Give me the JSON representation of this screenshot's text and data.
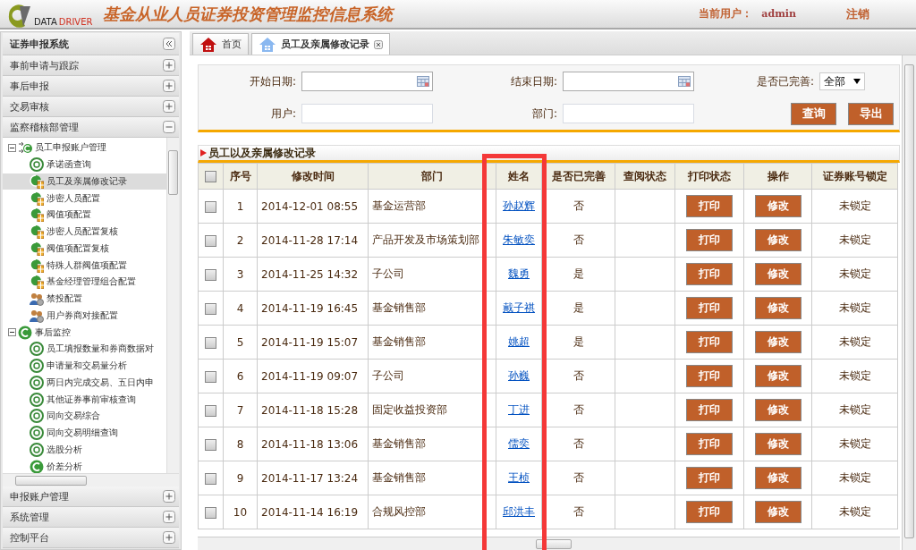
{
  "header": {
    "logo_words": [
      "DATA",
      "DRIVER"
    ],
    "title": "基金从业人员证券投资管理监控信息系统",
    "user_label": "当前用户：",
    "user": "admin",
    "logout": "注销"
  },
  "sidebar": {
    "title": "证券申报系统",
    "sections": [
      {
        "label": "事前申请与跟踪",
        "expanded": false
      },
      {
        "label": "事后申报",
        "expanded": false
      },
      {
        "label": "交易审核",
        "expanded": false
      },
      {
        "label": "监察稽核部管理",
        "expanded": true,
        "tree": [
          {
            "label": "员工申报账户管理",
            "kind": "folder",
            "expanded": true,
            "selected": false,
            "children": [
              {
                "label": "承诺函查询",
                "kind": "query",
                "selected": false
              },
              {
                "label": "员工及亲属修改记录",
                "kind": "config",
                "selected": true
              },
              {
                "label": "涉密人员配置",
                "kind": "config",
                "selected": false
              },
              {
                "label": "阀值项配置",
                "kind": "config",
                "selected": false
              },
              {
                "label": "涉密人员配置复核",
                "kind": "config",
                "selected": false
              },
              {
                "label": "阀值项配置复核",
                "kind": "config",
                "selected": false
              },
              {
                "label": "特殊人群阀值项配置",
                "kind": "config",
                "selected": false
              },
              {
                "label": "基金经理管理组合配置",
                "kind": "config",
                "selected": false
              },
              {
                "label": "禁投配置",
                "kind": "people",
                "selected": false
              },
              {
                "label": "用户券商对接配置",
                "kind": "people",
                "selected": false
              }
            ]
          },
          {
            "label": "事后监控",
            "kind": "group",
            "expanded": true,
            "selected": false,
            "children": [
              {
                "label": "员工填报数量和券商数据对",
                "kind": "query",
                "selected": false
              },
              {
                "label": "申请量和交易量分析",
                "kind": "query",
                "selected": false
              },
              {
                "label": "两日内完成交易、五日内申",
                "kind": "query",
                "selected": false
              },
              {
                "label": "其他证券事前审核查询",
                "kind": "query",
                "selected": false
              },
              {
                "label": "同向交易综合",
                "kind": "query",
                "selected": false
              },
              {
                "label": "同向交易明细查询",
                "kind": "query",
                "selected": false
              },
              {
                "label": "选股分析",
                "kind": "query",
                "selected": false
              },
              {
                "label": "价差分析",
                "kind": "group",
                "selected": false
              }
            ]
          }
        ]
      },
      {
        "label": "申报账户管理",
        "expanded": false
      },
      {
        "label": "系统管理",
        "expanded": false
      },
      {
        "label": "控制平台",
        "expanded": false
      }
    ]
  },
  "tabs": [
    {
      "label": "首页",
      "kind": "home",
      "selected": false,
      "closable": false
    },
    {
      "label": "员工及亲属修改记录",
      "kind": "page",
      "selected": true,
      "closable": true
    }
  ],
  "filters": {
    "start_date": {
      "label": "开始日期:"
    },
    "end_date": {
      "label": "结束日期:"
    },
    "complete": {
      "label": "是否已完善:",
      "value": "全部"
    },
    "user": {
      "label": "用户:"
    },
    "department": {
      "label": "部门:"
    },
    "buttons": [
      "查询",
      "导出"
    ]
  },
  "table": {
    "title": "员工以及亲属修改记录",
    "header_checked": false,
    "columns": [
      "序号",
      "修改时间",
      "部门",
      "姓名",
      "是否已完善",
      "查阅状态",
      "打印状态",
      "操作",
      "证券账号锁定"
    ],
    "rows": [
      {
        "checked": false,
        "no": "1",
        "time": "2014-12-01 08:55",
        "department": "基金运营部",
        "name": "孙赵辉",
        "complete": "否",
        "print": "打印",
        "edit": "修改",
        "lock": "未锁定"
      },
      {
        "checked": false,
        "no": "2",
        "time": "2014-11-28 17:14",
        "department": "产品开发及市场策划部",
        "name": "朱敏奕",
        "complete": "否",
        "print": "打印",
        "edit": "修改",
        "lock": "未锁定"
      },
      {
        "checked": false,
        "no": "3",
        "time": "2014-11-25 14:32",
        "department": "子公司",
        "name": "魏勇",
        "complete": "是",
        "print": "打印",
        "edit": "修改",
        "lock": "未锁定"
      },
      {
        "checked": false,
        "no": "4",
        "time": "2014-11-19 16:45",
        "department": "基金销售部",
        "name": "戴子祺",
        "complete": "是",
        "print": "打印",
        "edit": "修改",
        "lock": "未锁定"
      },
      {
        "checked": false,
        "no": "5",
        "time": "2014-11-19 15:07",
        "department": "基金销售部",
        "name": "姚超",
        "complete": "是",
        "print": "打印",
        "edit": "修改",
        "lock": "未锁定"
      },
      {
        "checked": false,
        "no": "6",
        "time": "2014-11-19 09:07",
        "department": "子公司",
        "name": "孙巍",
        "complete": "否",
        "print": "打印",
        "edit": "修改",
        "lock": "未锁定"
      },
      {
        "checked": false,
        "no": "7",
        "time": "2014-11-18 15:28",
        "department": "固定收益投资部",
        "name": "丁进",
        "complete": "否",
        "print": "打印",
        "edit": "修改",
        "lock": "未锁定"
      },
      {
        "checked": false,
        "no": "8",
        "time": "2014-11-18 13:06",
        "department": "基金销售部",
        "name": "儒奕",
        "complete": "否",
        "print": "打印",
        "edit": "修改",
        "lock": "未锁定"
      },
      {
        "checked": false,
        "no": "9",
        "time": "2014-11-17 13:24",
        "department": "基金销售部",
        "name": "王桢",
        "complete": "否",
        "print": "打印",
        "edit": "修改",
        "lock": "未锁定"
      },
      {
        "checked": false,
        "no": "10",
        "time": "2014-11-14 16:19",
        "department": "合规风控部",
        "name": "邱洪丰",
        "complete": "否",
        "print": "打印",
        "edit": "修改",
        "lock": "未锁定"
      }
    ]
  }
}
